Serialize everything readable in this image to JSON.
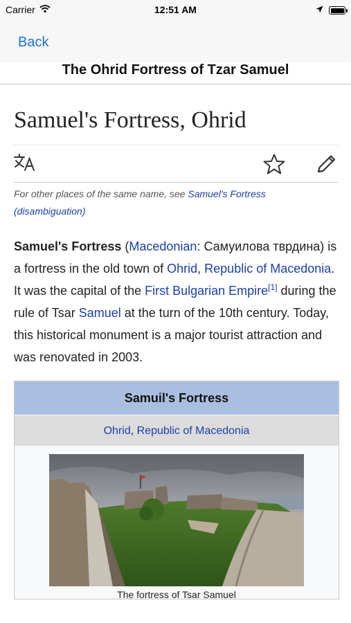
{
  "status": {
    "carrier": "Carrier",
    "time": "12:51 AM",
    "battery_level": 1.0
  },
  "nav": {
    "back_label": "Back",
    "title": "The Ohrid Fortress of Tzar Samuel"
  },
  "article": {
    "heading": "Samuel's Fortress, Ohrid",
    "hatnote": {
      "prefix": "For other places of the same name, see ",
      "link": "Samuel's Fortress (disambiguation)"
    },
    "lead": {
      "bold_name": "Samuel's Fortress",
      "t1": " (",
      "link_macedonian": "Macedonian",
      "t2": ": Самуилова тврдина) is a fortress in the old town of ",
      "link_ohrid": "Ohrid",
      "t3": ", ",
      "link_republic": "Republic of Macedonia",
      "t4": ". It was the capital of the ",
      "link_empire": "First Bulgarian Empire",
      "cite": "[1]",
      "t5": " during the rule of Tsar ",
      "link_samuel": "Samuel",
      "t6": " at the turn of the 10th century. Today, this historical monument is a major tourist attraction and was renovated in 2003."
    },
    "infobox": {
      "title": "Samuil's Fortress",
      "link_ohrid": "Ohrid",
      "separator": ", ",
      "link_republic": "Republic of Macedonia",
      "caption": "The fortress of Tsar Samuel"
    }
  },
  "icons": {
    "status": [
      "wifi-icon",
      "location-arrow-icon",
      "battery-icon"
    ],
    "toolbar": [
      "language-icon",
      "star-icon",
      "edit-pencil-icon"
    ]
  },
  "colors": {
    "link": "#1a3fa8",
    "nav_link": "#1a73d9",
    "infobox_header": "#a9bfe0",
    "infobox_subheader": "#dcdcdc"
  }
}
